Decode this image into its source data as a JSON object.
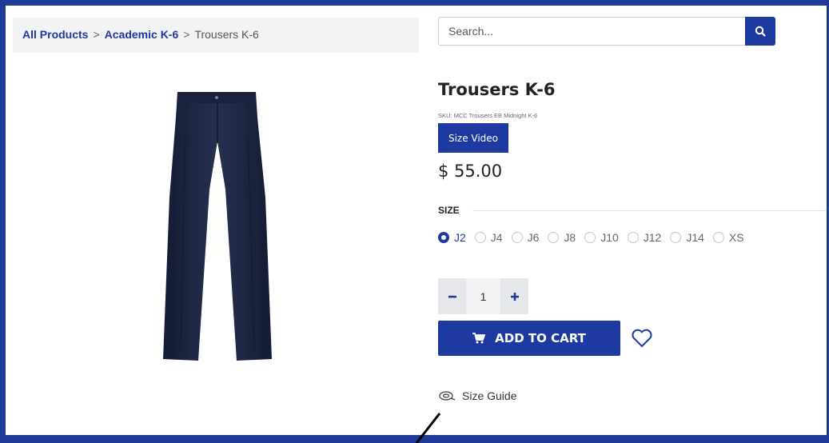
{
  "breadcrumb": {
    "items": [
      "All Products",
      "Academic K-6"
    ],
    "separator": ">",
    "current": "Trousers K-6"
  },
  "search": {
    "placeholder": "Search...",
    "icon": "search-icon"
  },
  "product": {
    "title": "Trousers K-6",
    "sku": "SKU: MCC Trousers EB Midnight K-6",
    "size_video_label": "Size Video",
    "price": "$ 55.00",
    "size_label": "SIZE",
    "sizes": [
      "J2",
      "J4",
      "J6",
      "J8",
      "J10",
      "J12",
      "J14",
      "XS"
    ],
    "selected_size": "J2",
    "quantity": "1",
    "add_to_cart_label": "ADD TO CART",
    "size_guide_label": "Size Guide"
  },
  "icons": {
    "cart": "cart-icon",
    "wishlist": "heart-icon",
    "size_guide": "tape-measure-icon",
    "minus": "minus-icon",
    "plus": "plus-icon"
  },
  "colors": {
    "brand": "#1e3aa0",
    "frame": "#1d3a9a"
  }
}
